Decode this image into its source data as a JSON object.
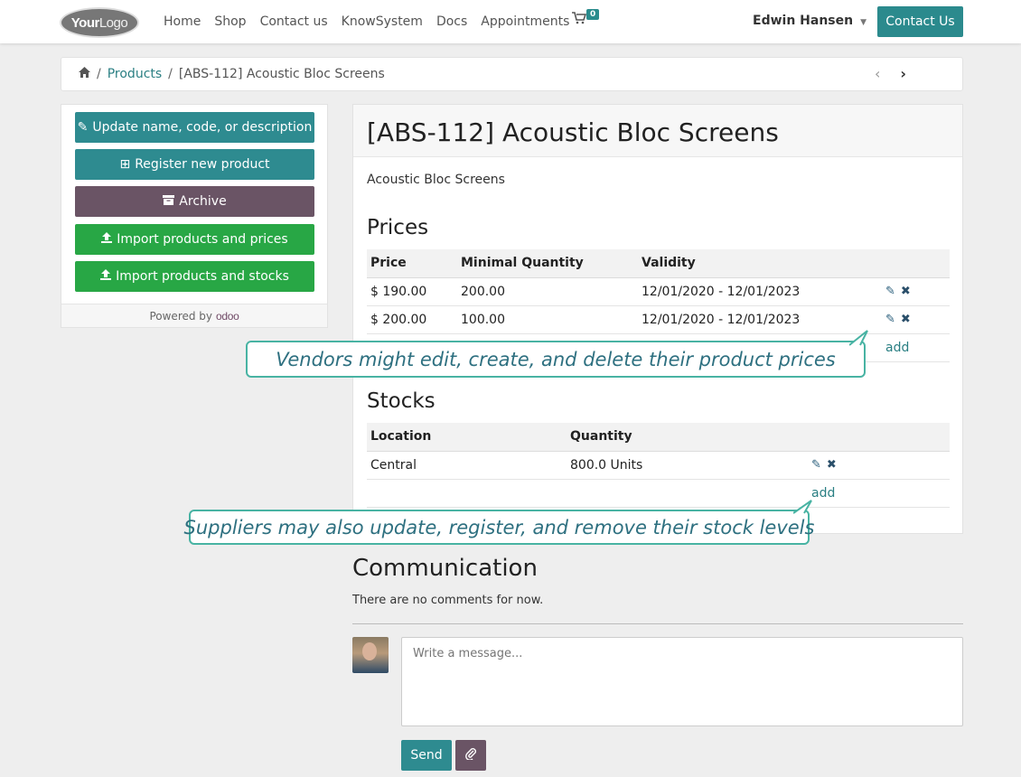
{
  "nav": {
    "logo_bold": "Your",
    "logo_light": "Logo",
    "menu": [
      "Home",
      "Shop",
      "Contact us",
      "KnowSystem",
      "Docs",
      "Appointments"
    ],
    "cart_icon": "shopping-cart-icon",
    "cart_count": "0",
    "user_name": "Edwin Hansen",
    "contact_button": "Contact Us"
  },
  "breadcrumb": {
    "home_icon": "home-icon",
    "sep1": "/",
    "products": "Products",
    "sep2": "/",
    "current": "[ABS-112] Acoustic Bloc Screens",
    "prev": "‹",
    "next": "›"
  },
  "sidebar": {
    "update": "Update name, code, or description",
    "register": "Register new product",
    "archive": "Archive",
    "import_prices": "Import products and prices",
    "import_stocks": "Import products and stocks",
    "powered_by": "Powered by",
    "odoo": "odoo"
  },
  "product": {
    "title": "[ABS-112] Acoustic Bloc Screens",
    "description": "Acoustic Bloc Screens"
  },
  "prices": {
    "title": "Prices",
    "headers": [
      "Price",
      "Minimal Quantity",
      "Validity"
    ],
    "rows": [
      {
        "price": "$ 190.00",
        "min_qty": "200.00",
        "validity": "12/01/2020 - 12/01/2023"
      },
      {
        "price": "$ 200.00",
        "min_qty": "100.00",
        "validity": "12/01/2020 - 12/01/2023"
      }
    ],
    "add": "add"
  },
  "stocks": {
    "title": "Stocks",
    "headers": [
      "Location",
      "Quantity"
    ],
    "rows": [
      {
        "location": "Central",
        "quantity": "800.0 Units"
      }
    ],
    "add": "add"
  },
  "callouts": {
    "prices": "Vendors might edit, create, and delete their product prices",
    "stocks": "Suppliers may also update, register, and remove their stock levels"
  },
  "communication": {
    "title": "Communication",
    "empty": "There are no comments for now.",
    "placeholder": "Write a message...",
    "send": "Send"
  },
  "colors": {
    "accent": "#2b8a8d",
    "plum": "#6a5465",
    "green": "#28a745",
    "callout_border": "#48b3a3"
  }
}
